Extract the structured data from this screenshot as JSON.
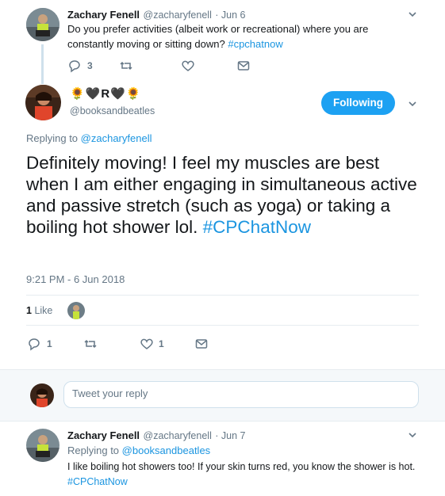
{
  "tweet1": {
    "name": "Zachary Fenell",
    "handle": "@zacharyfenell",
    "date": "· Jun 6",
    "text": "Do you prefer activities (albeit work or recreational) where you are constantly moving or sitting down?",
    "hashtag": "#cpchatnow",
    "reply_count": "3"
  },
  "main": {
    "display_name": "🌻🖤R🖤🌻",
    "handle": "@booksandbeatles",
    "follow_label": "Following",
    "replying_prefix": "Replying to",
    "replying_to": "@zacharyfenell",
    "text": "Definitely moving! I feel my muscles are best when I am either engaging in simultaneous active and passive stretch (such as yoga) or taking a boiling hot shower lol.",
    "hashtag": "#CPChatNow",
    "timestamp": "9:21 PM - 6 Jun 2018",
    "likes_count": "1",
    "likes_label": "Like",
    "reply_count": "1",
    "like_count": "1"
  },
  "composer": {
    "placeholder": "Tweet your reply"
  },
  "tweet3": {
    "name": "Zachary Fenell",
    "handle": "@zacharyfenell",
    "date": "· Jun 7",
    "replying_prefix": "Replying to",
    "replying_to": "@booksandbeatles",
    "text": "I like boiling hot showers too! If your skin turns red, you know the shower is hot.",
    "hashtag": "#CPChatNow"
  },
  "colors": {
    "accent": "#1da1f2",
    "link": "#1b95e0",
    "muted": "#657786"
  }
}
